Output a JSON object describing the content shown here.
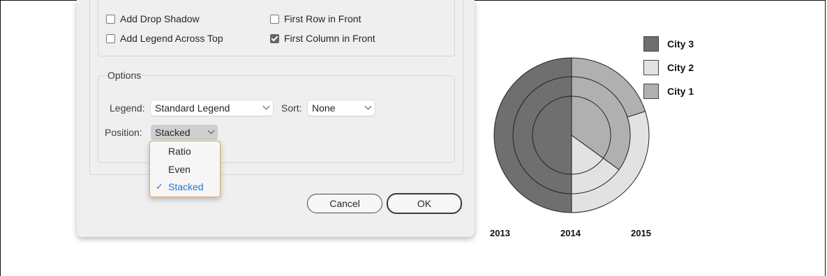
{
  "dialog": {
    "checkboxes": [
      {
        "label": "Add Drop Shadow",
        "checked": false
      },
      {
        "label": "First Row in Front",
        "checked": false
      },
      {
        "label": "Add Legend Across Top",
        "checked": false
      },
      {
        "label": "First Column in Front",
        "checked": true
      }
    ],
    "options": {
      "title": "Options",
      "legend_label": "Legend:",
      "legend_value": "Standard Legend",
      "sort_label": "Sort:",
      "sort_value": "None",
      "position_label": "Position:",
      "position_value": "Stacked"
    },
    "position_menu": {
      "items": [
        {
          "label": "Ratio",
          "selected": false
        },
        {
          "label": "Even",
          "selected": false
        },
        {
          "label": "Stacked",
          "selected": true
        }
      ],
      "checkmark": "✓"
    },
    "buttons": {
      "cancel": "Cancel",
      "ok": "OK"
    }
  },
  "chart_data": {
    "type": "pie",
    "title": "",
    "legend_position": "top-right",
    "series": [
      {
        "name": "City 3",
        "color": "#6f6f6f"
      },
      {
        "name": "City 2",
        "color": "#e2e2e2"
      },
      {
        "name": "City 1",
        "color": "#b0b0b0"
      }
    ],
    "pies": [
      {
        "label": "2013",
        "ring": "outer",
        "values": [
          50,
          30,
          20
        ]
      },
      {
        "label": "2014",
        "ring": "middle",
        "values": [
          50,
          15,
          35
        ]
      },
      {
        "label": "2015",
        "ring": "inner",
        "values": [
          50,
          15,
          35
        ]
      }
    ],
    "stroke_color": "#222222"
  }
}
